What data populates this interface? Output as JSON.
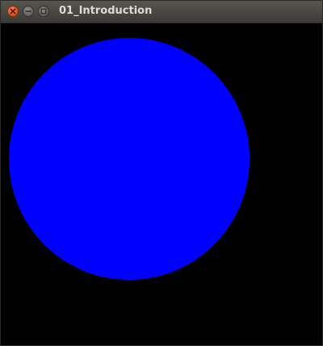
{
  "window": {
    "title": "01_Introduction"
  },
  "titlebar": {
    "buttons": [
      {
        "name": "close",
        "icon": "close-icon"
      },
      {
        "name": "minimize",
        "icon": "minimize-icon"
      },
      {
        "name": "maximize",
        "icon": "maximize-icon"
      }
    ]
  },
  "canvas": {
    "background": "#000000",
    "shape": "circle",
    "circle_color": "#0000ff"
  }
}
